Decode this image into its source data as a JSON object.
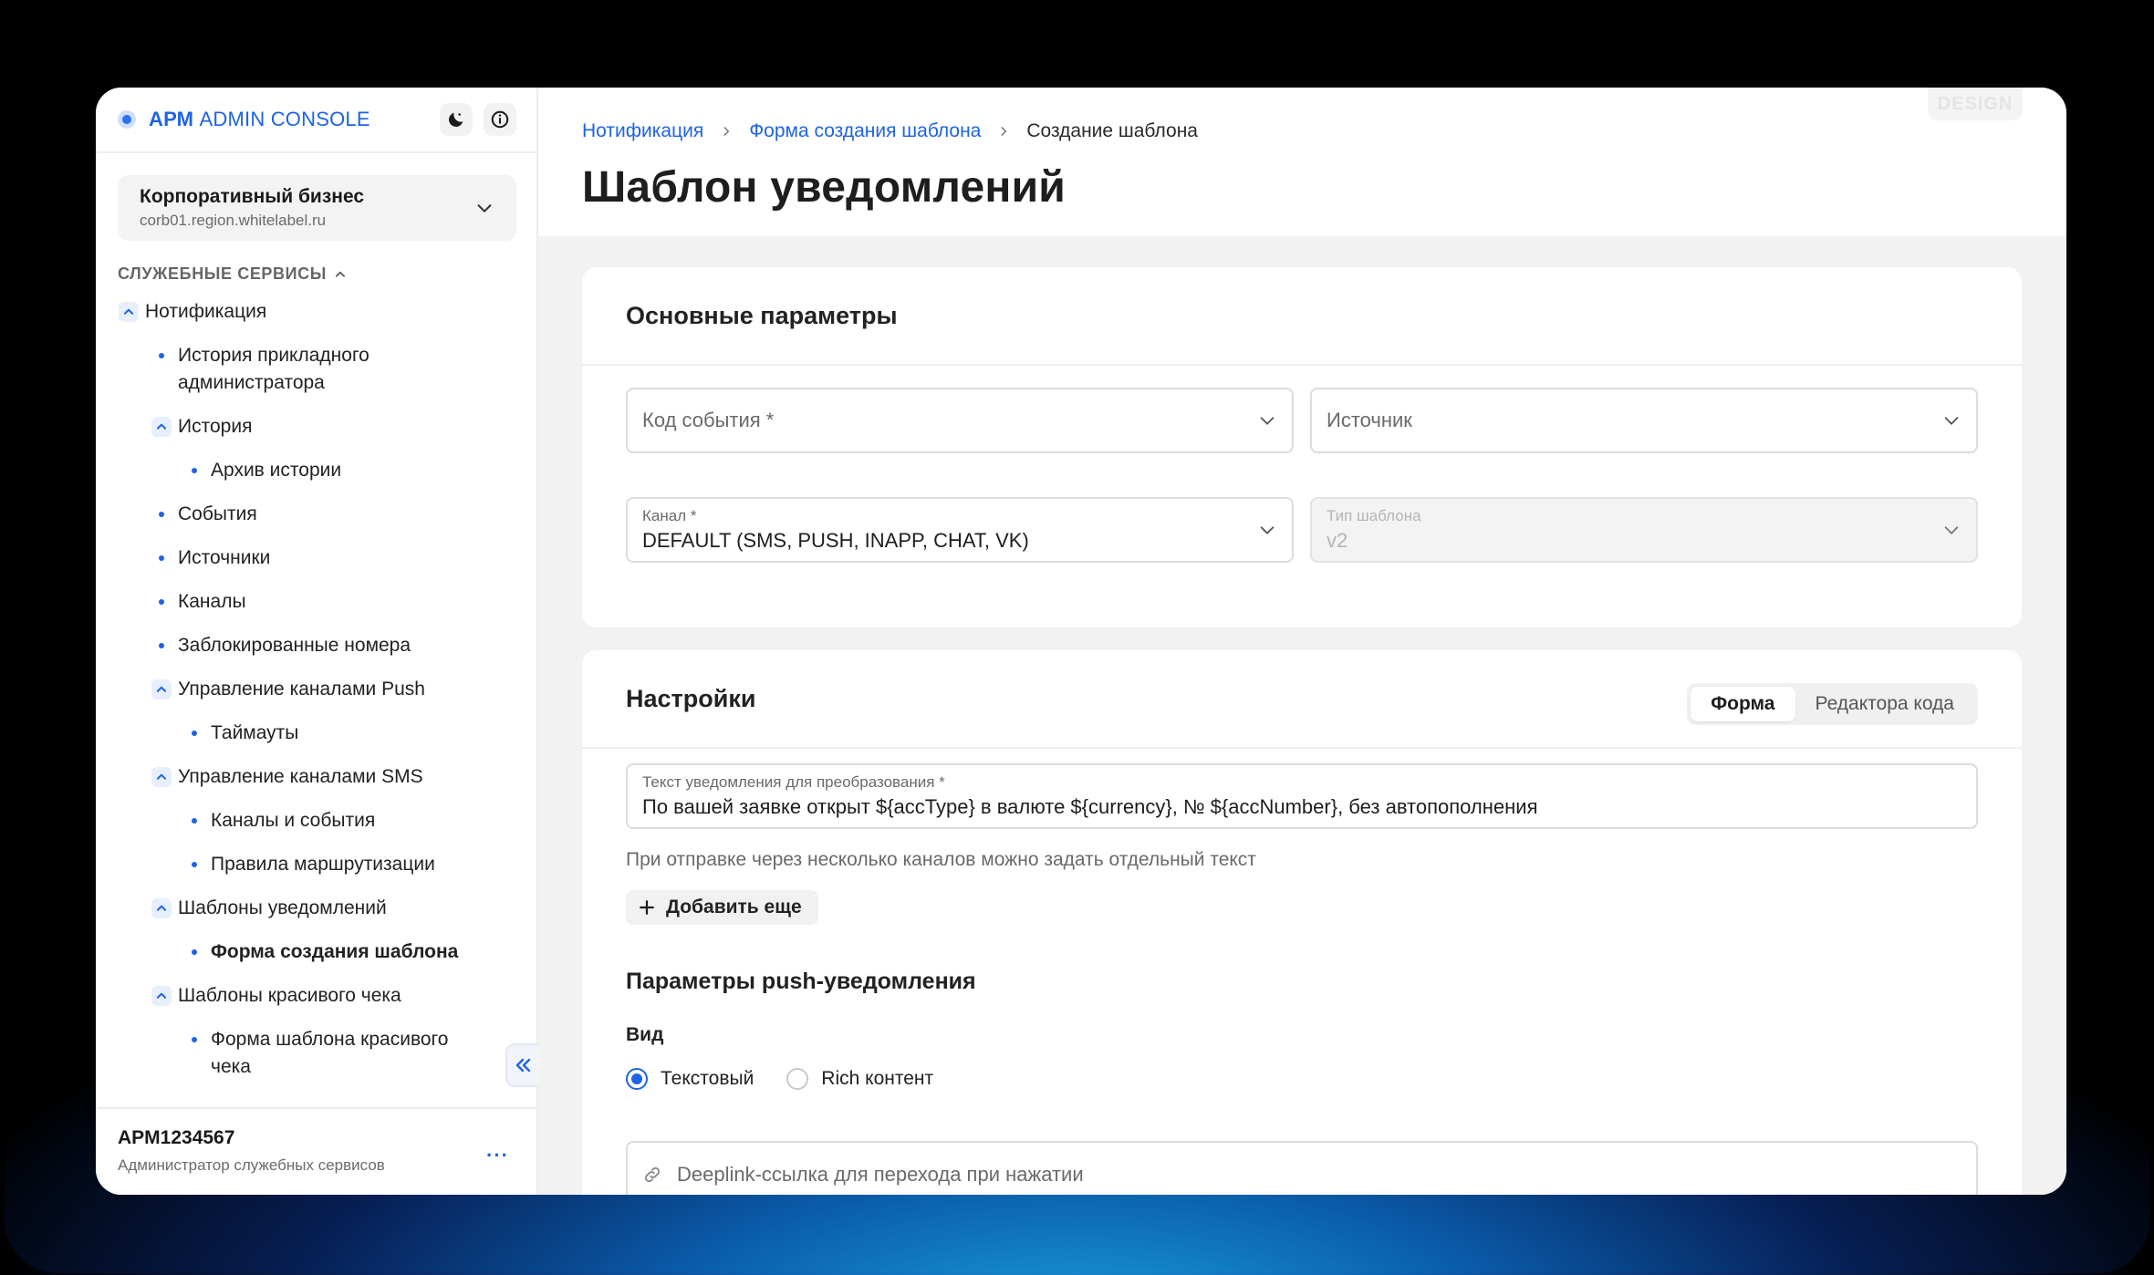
{
  "app": {
    "title_bold": "АРМ",
    "title_rest": " ADMIN CONSOLE"
  },
  "org": {
    "name": "Корпоративный бизнес",
    "domain": "corb01.region.whitelabel.ru"
  },
  "sidebar": {
    "section_title": "СЛУЖЕБНЫЕ СЕРВИСЫ",
    "items": [
      {
        "label": "Нотификация"
      },
      {
        "label": "История прикладного администратора"
      },
      {
        "label": "История"
      },
      {
        "label": "Архив истории"
      },
      {
        "label": "События"
      },
      {
        "label": "Источники"
      },
      {
        "label": "Каналы"
      },
      {
        "label": "Заблокированные номера"
      },
      {
        "label": "Управление каналами Push"
      },
      {
        "label": "Таймауты"
      },
      {
        "label": "Управление каналами SMS"
      },
      {
        "label": "Каналы и события"
      },
      {
        "label": "Правила маршрутизации"
      },
      {
        "label": "Шаблоны уведомлений"
      },
      {
        "label": "Форма создания шаблона"
      },
      {
        "label": "Шаблоны красивого чека"
      },
      {
        "label": "Форма шаблона красивого чека"
      }
    ]
  },
  "user": {
    "login": "APM1234567",
    "role": "Администратор служебных сервисов",
    "more": "···"
  },
  "breadcrumb": {
    "items": [
      "Нотификация",
      "Форма создания шаблона"
    ],
    "current": "Создание шаблона"
  },
  "page": {
    "title": "Шаблон уведомлений",
    "badge": "DESIGN"
  },
  "params": {
    "title": "Основные параметры",
    "event_code": {
      "placeholder": "Код события *"
    },
    "source": {
      "placeholder": "Источник"
    },
    "channel": {
      "label": "Канал *",
      "value": "DEFAULT (SMS, PUSH, INAPP, CHAT, VK)"
    },
    "template_type": {
      "label": "Тип шаблона",
      "value": "v2"
    }
  },
  "settings": {
    "title": "Настройки",
    "tabs": [
      {
        "label": "Форма",
        "selected": true
      },
      {
        "label": "Редактора кода",
        "selected": false
      }
    ],
    "text_field": {
      "label": "Текст уведомления для преобразования *",
      "value": "По вашей заявке открыт ${accType} в валюте ${currency}, № ${accNumber}, без автопополнения"
    },
    "hint": "При отправке через несколько каналов можно задать отдельный текст",
    "add_more": "Добавить еще",
    "push_title": "Параметры push-уведомления",
    "view_label": "Вид",
    "view_options": [
      {
        "label": "Текстовый",
        "selected": true
      },
      {
        "label": "Rich контент",
        "selected": false
      }
    ],
    "deeplink_placeholder": "Deeplink-ссылка для перехода при нажатии"
  },
  "colors": {
    "accent": "#1e63e6",
    "background": "#f2f2f2"
  }
}
